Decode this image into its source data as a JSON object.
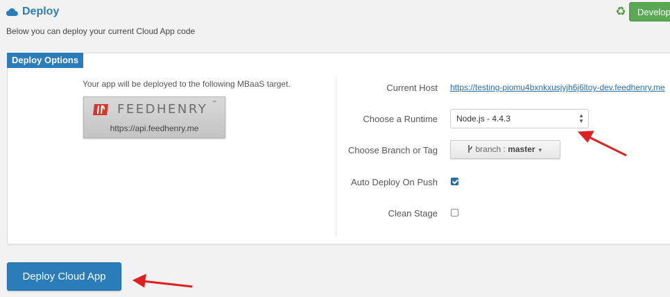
{
  "header": {
    "title": "Deploy",
    "subtitle": "Below you can deploy your current Cloud App code",
    "env_button_label": "Develop"
  },
  "panel": {
    "tab_label": "Deploy Options",
    "target_text": "Your app will be deployed to the following MBaaS target.",
    "mbaas": {
      "logo_text": "FEEDHENRY",
      "trademark": "™",
      "url": "https://api.feedhenry.me"
    },
    "form": {
      "current_host_label": "Current Host",
      "current_host_value": "https://testing-piomu4bxnkxusjyjh6j6ltoy-dev.feedhenry.me",
      "runtime_label": "Choose a Runtime",
      "runtime_value": "Node.js - 4.4.3",
      "branch_label": "Choose Branch or Tag",
      "branch_prefix": "branch :",
      "branch_value": "master",
      "auto_deploy_label": "Auto Deploy On Push",
      "auto_deploy_checked": true,
      "clean_stage_label": "Clean Stage",
      "clean_stage_checked": false
    }
  },
  "deploy_button_label": "Deploy Cloud App",
  "colors": {
    "accent": "#2a7db8",
    "env_button": "#5aa854",
    "annotation_arrow": "#e02020",
    "logo_red": "#d8362b"
  },
  "icons": {
    "title_icon": "cloud-icon",
    "env_icon": "recycle-icon",
    "branch_icon": "git-branch-icon"
  }
}
